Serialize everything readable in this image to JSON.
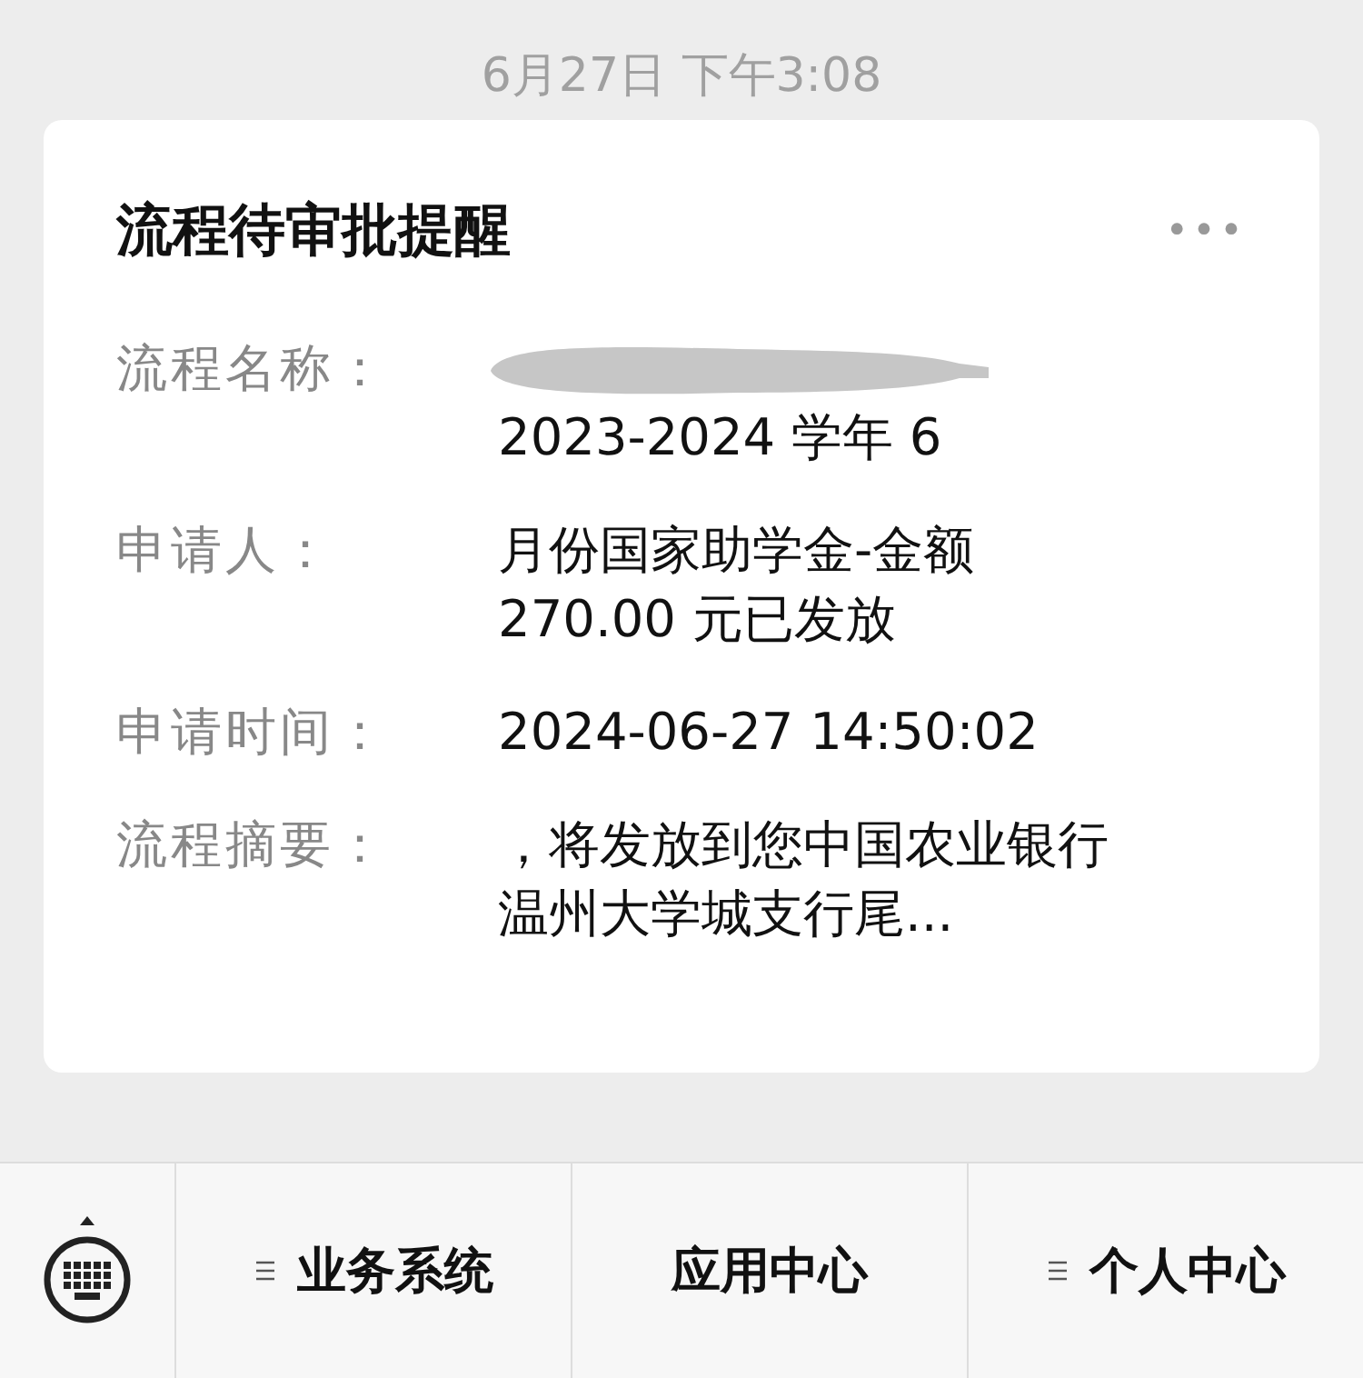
{
  "timestamp": "6月27日 下午3:08",
  "card": {
    "title": "流程待审批提醒",
    "more_icon": "•••",
    "fields": [
      {
        "label": "流程名称：",
        "lines": [
          {
            "kind": "redacted"
          },
          {
            "kind": "text",
            "text": "2023-2024 学年 6"
          }
        ]
      },
      {
        "label": "申请人：",
        "lines": [
          {
            "kind": "text",
            "text": "月份国家助学金-金额"
          },
          {
            "kind": "text",
            "text": "270.00 元已发放"
          }
        ]
      },
      {
        "label": "申请时间：",
        "lines": [
          {
            "kind": "text",
            "text": "2024-06-27 14:50:02"
          }
        ]
      },
      {
        "label": "流程摘要：",
        "lines": [
          {
            "kind": "text",
            "text": "，将发放到您中国农业银行"
          },
          {
            "kind": "text",
            "text": "温州大学城支行尾..."
          }
        ]
      }
    ]
  },
  "menu": [
    {
      "label": "业务系统",
      "has_submenu": true
    },
    {
      "label": "应用中心",
      "has_submenu": false
    },
    {
      "label": "个人中心",
      "has_submenu": true
    }
  ]
}
